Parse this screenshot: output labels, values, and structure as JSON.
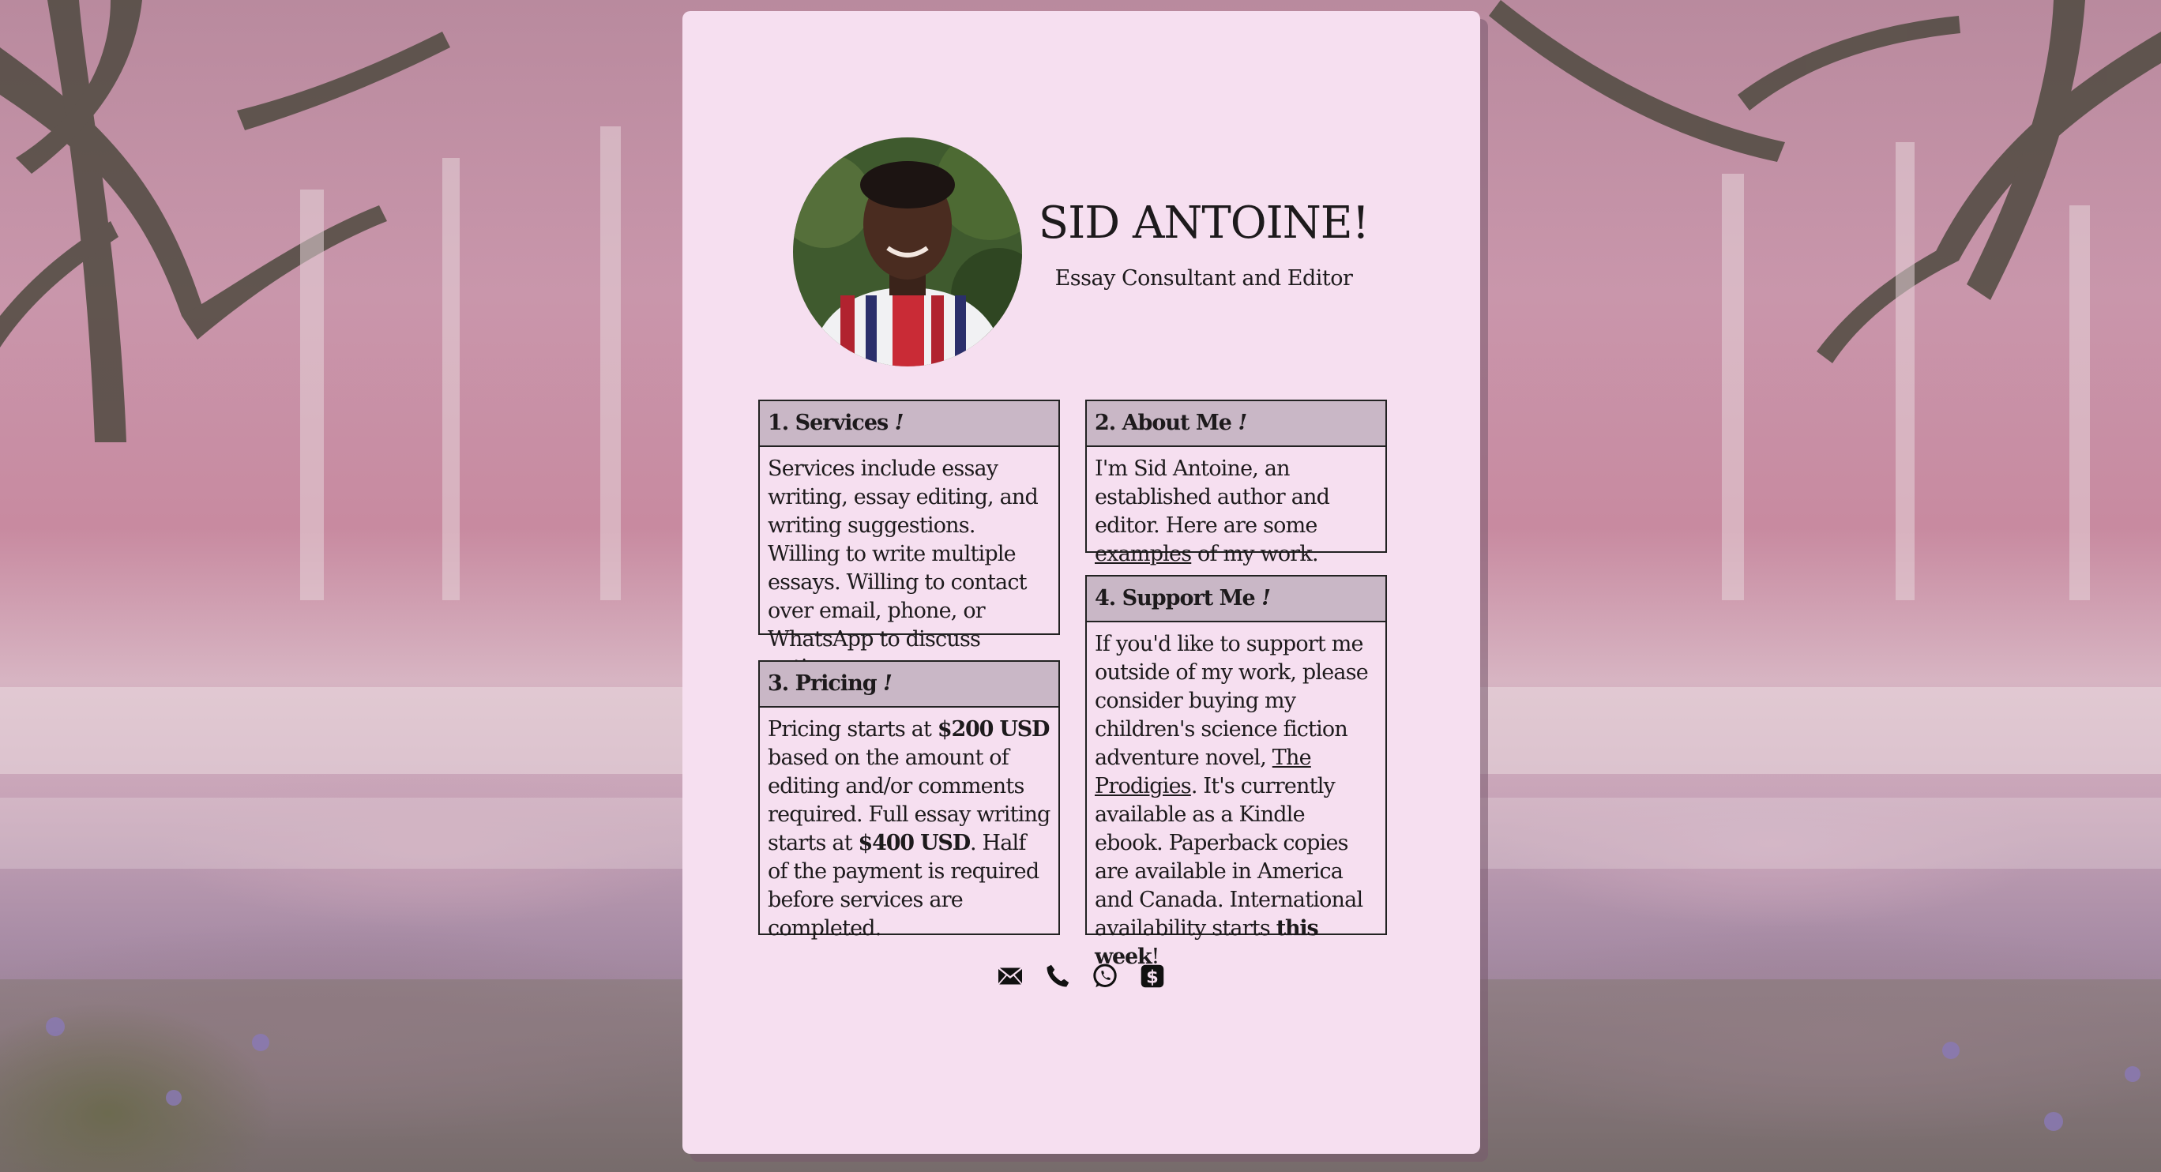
{
  "header": {
    "name": "SID ANTOINE!",
    "tagline": "Essay Consultant and Editor"
  },
  "sections": {
    "services": {
      "title": "1. Services",
      "bang": "!",
      "text": "Services include essay writing, essay editing, and writing suggestions. Willing to write multiple essays. Willing to contact over email, phone, or WhatsApp to discuss options."
    },
    "about": {
      "title": "2. About Me",
      "bang": "!",
      "text_before": "I'm Sid Antoine, an established author and editor. Here are some ",
      "link": "examples",
      "text_after": " of my work."
    },
    "pricing": {
      "title": "3. Pricing",
      "bang": "!",
      "p1": "Pricing starts at ",
      "price1": "$200 USD",
      "p2": " based on the amount of editing and/or comments required. Full essay writing starts at ",
      "price2": "$400 USD",
      "p3": ". Half of the payment is required before services are completed."
    },
    "support": {
      "title": "4. Support Me",
      "bang": "!",
      "p1": "If you'd like to support me outside of my work, please consider buying my children's science fiction adventure novel, ",
      "link": "The Prodigies",
      "p2": ". It's currently available as a Kindle ebook. Paperback copies are available in America and Canada. International availability starts ",
      "bold": "this week",
      "p3": "!"
    }
  },
  "contact_icons": [
    "envelope-icon",
    "phone-icon",
    "whatsapp-icon",
    "dollar-icon"
  ],
  "colors": {
    "card_bg": "#f6dff0",
    "header_bg": "#c9b7c6",
    "text": "#1d1a1c"
  }
}
